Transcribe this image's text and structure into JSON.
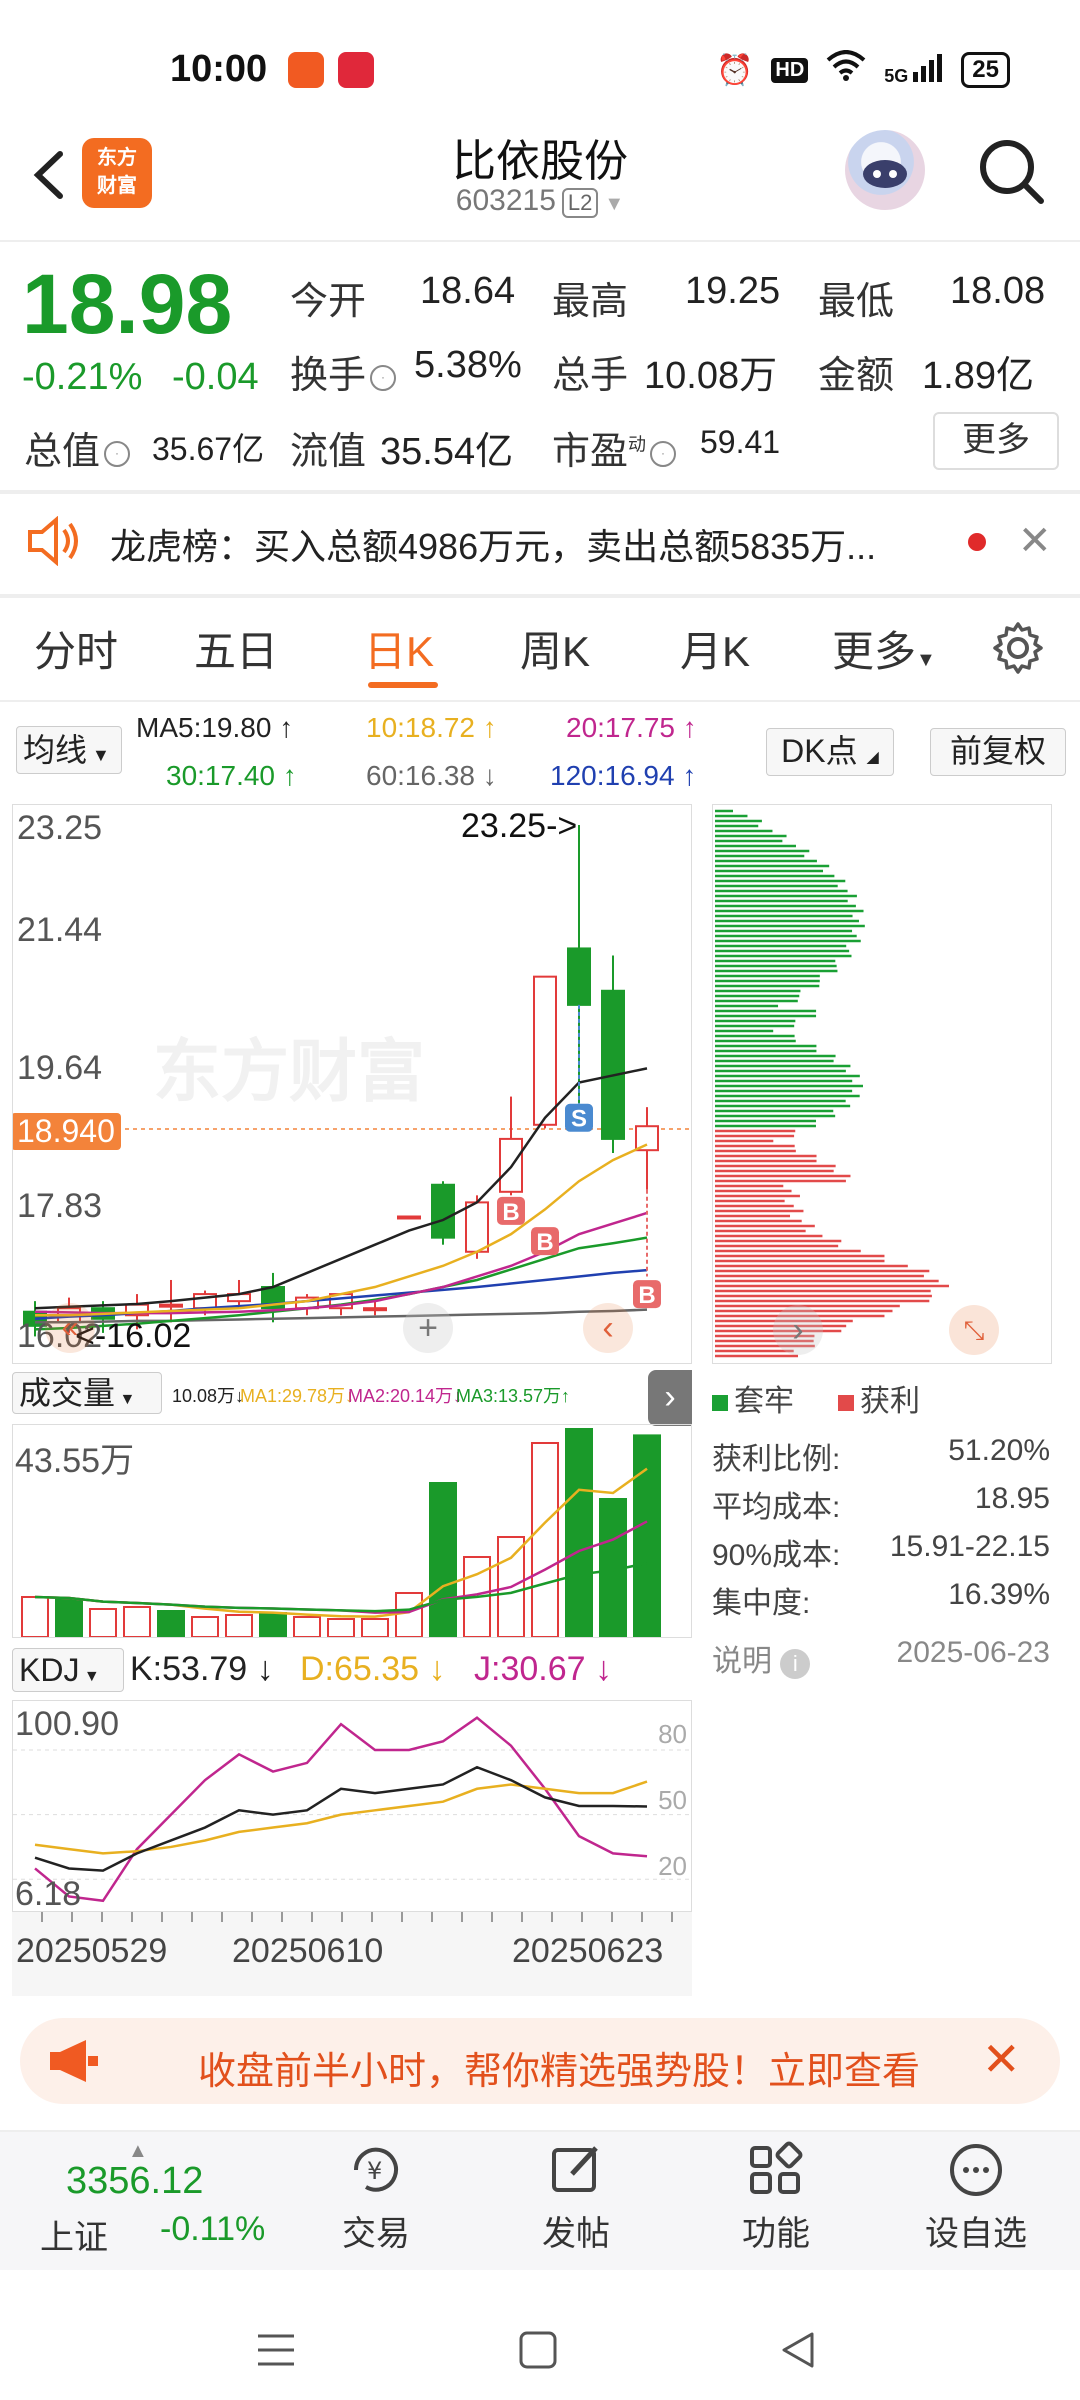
{
  "status_bar": {
    "time": "10:00",
    "battery": "25",
    "network": "5G",
    "hd": "HD"
  },
  "header": {
    "stock_name": "比依股份",
    "stock_code": "603215",
    "level": "L2",
    "logo_line1": "东方",
    "logo_line2": "财富"
  },
  "quote": {
    "last_price": "18.98",
    "pct_change": "-0.21%",
    "abs_change": "-0.04",
    "open_label": "今开",
    "open": "18.64",
    "high_label": "最高",
    "high": "19.25",
    "low_label": "最低",
    "low": "18.08",
    "turnover_label": "换手",
    "turnover": "5.38%",
    "volume_label": "总手",
    "volume": "10.08万",
    "amount_label": "金额",
    "amount": "1.89亿",
    "mktcap_label": "总值",
    "mktcap": "35.67亿",
    "float_label": "流值",
    "float_cap": "35.54亿",
    "pe_label": "市盈",
    "pe_sup": "动",
    "pe": "59.41",
    "more_label": "更多"
  },
  "notice": {
    "text": "龙虎榜：买入总额4986万元，卖出总额5835万..."
  },
  "tabs": [
    "分时",
    "五日",
    "日K",
    "周K",
    "月K",
    "更多"
  ],
  "ma": {
    "selector": "均线",
    "ma5": "MA5:19.80",
    "ma10": "10:18.72",
    "ma20": "20:17.75",
    "ma30": "30:17.40",
    "ma60": "60:16.38",
    "ma120": "120:16.94",
    "dk_label": "DK点",
    "adjust_label": "前复权"
  },
  "kline": {
    "y_labels": [
      "23.25",
      "21.44",
      "19.64",
      "17.83",
      "16.02"
    ],
    "current_tag": "18.940",
    "high_marker": "23.25->",
    "low_marker": "<-16.02",
    "watermark": "东方财富",
    "signal_s": "S",
    "signal_b": "B"
  },
  "chart_data": {
    "type": "candlestick",
    "candles": [
      {
        "o": 16.35,
        "c": 16.15,
        "h": 16.5,
        "l": 16.0
      },
      {
        "o": 16.2,
        "c": 16.4,
        "h": 16.55,
        "l": 16.05
      },
      {
        "o": 16.4,
        "c": 16.25,
        "h": 16.5,
        "l": 16.05
      },
      {
        "o": 16.3,
        "c": 16.45,
        "h": 16.6,
        "l": 16.1
      },
      {
        "o": 16.45,
        "c": 16.45,
        "h": 16.8,
        "l": 16.2
      },
      {
        "o": 16.4,
        "c": 16.6,
        "h": 16.65,
        "l": 16.3
      },
      {
        "o": 16.5,
        "c": 16.6,
        "h": 16.8,
        "l": 16.4
      },
      {
        "o": 16.7,
        "c": 16.4,
        "h": 16.9,
        "l": 16.2
      },
      {
        "o": 16.4,
        "c": 16.55,
        "h": 16.6,
        "l": 16.3
      },
      {
        "o": 16.4,
        "c": 16.6,
        "h": 16.6,
        "l": 16.3
      },
      {
        "o": 16.4,
        "c": 16.4,
        "h": 16.5,
        "l": 16.3
      },
      {
        "o": 17.7,
        "c": 17.7,
        "h": 17.7,
        "l": 17.7
      },
      {
        "o": 18.15,
        "c": 17.4,
        "h": 18.2,
        "l": 17.3
      },
      {
        "o": 17.2,
        "c": 17.9,
        "h": 18.0,
        "l": 17.1
      },
      {
        "o": 18.05,
        "c": 18.8,
        "h": 19.4,
        "l": 18.0
      },
      {
        "o": 19.0,
        "c": 21.1,
        "h": 21.1,
        "l": 18.95
      },
      {
        "o": 21.5,
        "c": 20.7,
        "h": 23.25,
        "l": 19.3
      },
      {
        "o": 20.9,
        "c": 18.8,
        "h": 21.4,
        "l": 18.6
      },
      {
        "o": 18.64,
        "c": 18.98,
        "h": 19.25,
        "l": 18.08
      }
    ],
    "ma5": [
      16.4,
      16.42,
      16.44,
      16.46,
      16.5,
      16.55,
      16.6,
      16.7,
      16.9,
      17.1,
      17.3,
      17.5,
      17.65,
      17.9,
      18.4,
      19.1,
      19.6,
      19.7,
      19.8
    ],
    "ma10": [
      16.3,
      16.3,
      16.32,
      16.34,
      16.36,
      16.38,
      16.4,
      16.45,
      16.5,
      16.6,
      16.7,
      16.85,
      17.0,
      17.2,
      17.45,
      17.8,
      18.2,
      18.5,
      18.72
    ],
    "ma20": [
      16.35,
      16.34,
      16.33,
      16.33,
      16.33,
      16.34,
      16.35,
      16.37,
      16.4,
      16.44,
      16.5,
      16.6,
      16.7,
      16.85,
      17.0,
      17.2,
      17.45,
      17.6,
      17.75
    ],
    "ma30": [
      16.1,
      16.12,
      16.15,
      16.18,
      16.22,
      16.26,
      16.3,
      16.35,
      16.4,
      16.45,
      16.52,
      16.6,
      16.7,
      16.8,
      16.95,
      17.1,
      17.25,
      17.32,
      17.4
    ],
    "ma60": [
      16.2,
      16.2,
      16.21,
      16.22,
      16.22,
      16.23,
      16.24,
      16.25,
      16.26,
      16.27,
      16.28,
      16.29,
      16.3,
      16.31,
      16.32,
      16.33,
      16.35,
      16.36,
      16.38
    ],
    "ma120": [
      16.25,
      16.28,
      16.3,
      16.33,
      16.36,
      16.4,
      16.43,
      16.46,
      16.5,
      16.54,
      16.58,
      16.62,
      16.66,
      16.7,
      16.75,
      16.8,
      16.85,
      16.9,
      16.94
    ],
    "volume": [
      2.0,
      1.9,
      1.4,
      1.5,
      1.3,
      1.0,
      1.1,
      1.2,
      1.0,
      0.9,
      0.9,
      2.2,
      7.7,
      4.0,
      5.0,
      9.7,
      10.4,
      6.9,
      10.08
    ],
    "vol_up": [
      false,
      true,
      false,
      false,
      true,
      false,
      false,
      true,
      false,
      false,
      false,
      false,
      true,
      false,
      false,
      false,
      true,
      true,
      true
    ],
    "k": [
      30,
      25,
      24,
      32,
      38,
      44,
      52,
      50,
      52,
      62,
      60,
      62,
      64,
      72,
      66,
      58,
      54,
      54,
      53.79
    ],
    "d": [
      36,
      34,
      32,
      33,
      35,
      38,
      42,
      44,
      46,
      50,
      52,
      54,
      56,
      62,
      64,
      62,
      60,
      60,
      65.35
    ],
    "j": [
      25,
      12,
      10,
      34,
      50,
      66,
      78,
      70,
      74,
      92,
      80,
      80,
      84,
      95,
      82,
      62,
      40,
      32,
      30.67
    ]
  },
  "vol": {
    "selector": "成交量",
    "vol_text": "10.08万↓",
    "ma1": "MA1:29.78万↓",
    "ma2": "MA2:20.14万↓",
    "ma3": "MA3:13.57万↑",
    "max_label": "43.55万"
  },
  "kdj": {
    "selector": "KDJ",
    "k": "K:53.79",
    "d": "D:65.35",
    "j": "J:30.67",
    "top": "100.90",
    "bottom": "6.18",
    "levels": [
      "80",
      "50",
      "20"
    ],
    "dates": [
      "20250529",
      "20250610",
      "20250623"
    ]
  },
  "chips": {
    "legend_trapped": "套牢",
    "legend_profit": "获利",
    "rows": [
      {
        "label": "获利比例:",
        "value": "51.20%"
      },
      {
        "label": "平均成本:",
        "value": "18.95"
      },
      {
        "label": "90%成本:",
        "value": "15.91-22.15"
      },
      {
        "label": "集中度:",
        "value": "16.39%"
      }
    ],
    "note_label": "说明",
    "date": "2025-06-23",
    "green": "#1aa034",
    "red": "#e24a4a"
  },
  "promo": {
    "text": "收盘前半小时，帮你精选强势股！立即查看"
  },
  "bottom": {
    "index_value": "3356.12",
    "index_name": "上证",
    "index_change": "-0.11%",
    "items": [
      "交易",
      "发帖",
      "功能",
      "设自选"
    ]
  },
  "colors": {
    "up": "#e23a3a",
    "down": "#1a9a2a",
    "accent": "#f36c21"
  }
}
